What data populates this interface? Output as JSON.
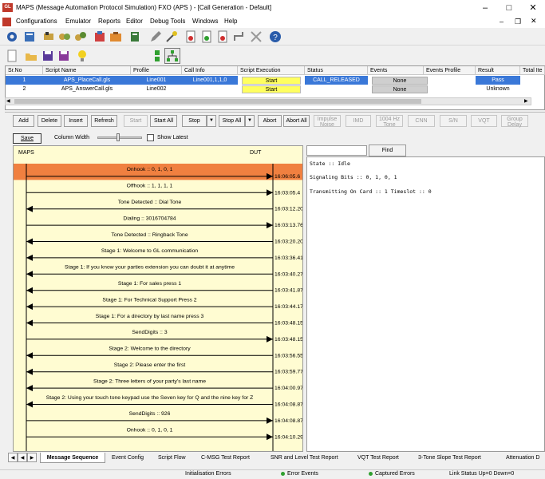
{
  "window": {
    "app_icon_text": "GL",
    "title": "MAPS (Message Automation Protocol Simulation) FXO (APS ) - [Call Generation - Default]"
  },
  "menu": [
    "Configurations",
    "Emulator",
    "Reports",
    "Editor",
    "Debug Tools",
    "Windows",
    "Help"
  ],
  "script_table": {
    "columns": [
      "Sr.No",
      "Script Name",
      "Profile",
      "Call Info",
      "Script Execution",
      "Status",
      "Events",
      "Events Profile",
      "Result",
      "Total Ite"
    ],
    "rows": [
      {
        "sr": "1",
        "script": "APS_PlaceCall.gls",
        "profile": "Line001",
        "call_info": "Line001,1,1,0",
        "exec": "Start",
        "status": "CALL_RELEASED",
        "events": "None",
        "events_profile": "",
        "result": "Pass",
        "total": ""
      },
      {
        "sr": "2",
        "script": "APS_AnswerCall.gls",
        "profile": "Line002",
        "call_info": "",
        "exec": "Start",
        "status": "",
        "events": "None",
        "events_profile": "",
        "result": "Unknown",
        "total": ""
      }
    ]
  },
  "commands": {
    "add": "Add",
    "delete": "Delete",
    "insert": "Insert",
    "refresh": "Refresh",
    "start": "Start",
    "start_all": "Start All",
    "stop": "Stop",
    "stop_all": "Stop All",
    "abort": "Abort",
    "abort_all": "Abort All",
    "impulse_1": "Impulse",
    "impulse_2": "Noise",
    "imd": "IMD",
    "tone_1": "1004 Hz",
    "tone_2": "Tone",
    "cnn": "CNN",
    "sn": "S/N",
    "vqt": "VQT",
    "group_1": "Group",
    "group_2": "Delay"
  },
  "ladder_controls": {
    "save": "Save",
    "column_width": "Column Width",
    "show_latest": "Show Latest",
    "column_width_level": 0.45
  },
  "ladder": {
    "left_entity": "MAPS",
    "right_entity": "DUT",
    "highlight_color": "#f08040",
    "messages": [
      {
        "label": "Onhook :: 0, 1, 0, 1",
        "dir": "right",
        "time": "16:06:05.6",
        "highlight": true
      },
      {
        "label": "Offhook :: 1, 1, 1, 1",
        "dir": "right",
        "time": "16:03:05.4"
      },
      {
        "label": "Tone Detected :: Dial Tone",
        "dir": "left",
        "time": "16:03:12.20"
      },
      {
        "label": "Dialing :: 3016704784",
        "dir": "right",
        "time": "16:03:13.76"
      },
      {
        "label": "Tone Detected :: Ringback Tone",
        "dir": "left",
        "time": "16:03:20.20"
      },
      {
        "label": "Stage 1: Welcome to GL communication",
        "dir": "left",
        "time": "16:03:36.41"
      },
      {
        "label": "Stage 1: If you know your parties extension you can doubt it at anytime",
        "dir": "left",
        "time": "16:03:40.27"
      },
      {
        "label": "Stage 1: For sales press 1",
        "dir": "left",
        "time": "16:03:41.87"
      },
      {
        "label": "Stage 1: For Technical Support Press 2",
        "dir": "left",
        "time": "16:03:44.17"
      },
      {
        "label": "Stage 1: For a directory by last name press 3",
        "dir": "left",
        "time": "16:03:48.15"
      },
      {
        "label": "SendDigits :: 3",
        "dir": "right",
        "time": "16:03:48.15"
      },
      {
        "label": "Stage 2: Welcome to the directory",
        "dir": "left",
        "time": "16:03:56.55"
      },
      {
        "label": "Stage 2: Please enter the first",
        "dir": "left",
        "time": "16:03:59.77"
      },
      {
        "label": "Stage 2: Three letters of your party's last name",
        "dir": "left",
        "time": "16:04:00.97"
      },
      {
        "label": "Stage 2: Using your touch tone keypad use the Seven key for Q and the nine key for Z",
        "dir": "left",
        "time": "16:04:08.87"
      },
      {
        "label": "SendDigits :: 926",
        "dir": "right",
        "time": "16:04:08.87"
      },
      {
        "label": "Onhook :: 0, 1, 0, 1",
        "dir": "right",
        "time": "16:04:10.29"
      }
    ]
  },
  "detail": {
    "find": "Find",
    "lines": [
      "State :: Idle",
      "Signaling Bits :: 0, 1, 0, 1",
      "Transmitting On Card :: 1 Timeslot :: 0"
    ]
  },
  "tabs": [
    "Message Sequence",
    "Event Config",
    "Script Flow",
    "C-MSG Test Report",
    "SNR and Level Test Report",
    "VQT Test Report",
    "3-Tone Slope Test Report",
    "Attenuation D"
  ],
  "status": [
    "Initialisation Errors",
    "Error Events",
    "Captured Errors",
    "Link Status Up=0 Down=0"
  ]
}
